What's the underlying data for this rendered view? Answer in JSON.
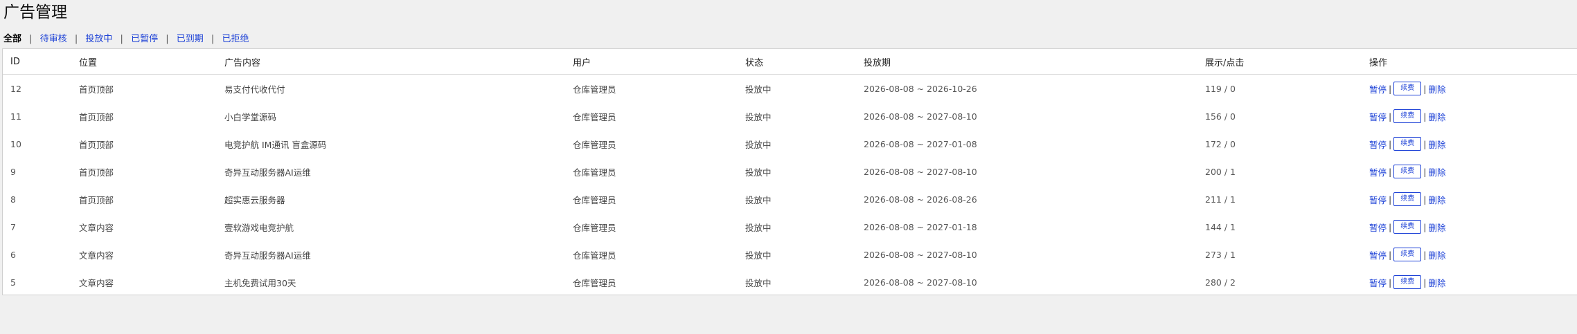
{
  "page": {
    "title": "广告管理"
  },
  "filters": [
    {
      "label": "全部",
      "active": true
    },
    {
      "label": "待审核",
      "active": false
    },
    {
      "label": "投放中",
      "active": false
    },
    {
      "label": "已暂停",
      "active": false
    },
    {
      "label": "已到期",
      "active": false
    },
    {
      "label": "已拒绝",
      "active": false
    }
  ],
  "filter_separator": "|",
  "table": {
    "headers": {
      "id": "ID",
      "position": "位置",
      "content": "广告内容",
      "user": "用户",
      "status": "状态",
      "period": "投放期",
      "stats": "展示/点击",
      "actions": "操作"
    },
    "rows": [
      {
        "id": "12",
        "position": "首页顶部",
        "content": "易支付代收代付",
        "user": "仓库管理员",
        "status": "投放中",
        "period": "2026-08-08 ~ 2026-10-26",
        "stats": "119 / 0"
      },
      {
        "id": "11",
        "position": "首页顶部",
        "content": "小白学堂源码",
        "user": "仓库管理员",
        "status": "投放中",
        "period": "2026-08-08 ~ 2027-08-10",
        "stats": "156 / 0"
      },
      {
        "id": "10",
        "position": "首页顶部",
        "content": "电竞护航 IM通讯 盲盒源码",
        "user": "仓库管理员",
        "status": "投放中",
        "period": "2026-08-08 ~ 2027-01-08",
        "stats": "172 / 0"
      },
      {
        "id": "9",
        "position": "首页顶部",
        "content": "奇异互动服务器AI运维",
        "user": "仓库管理员",
        "status": "投放中",
        "period": "2026-08-08 ~ 2027-08-10",
        "stats": "200 / 1"
      },
      {
        "id": "8",
        "position": "首页顶部",
        "content": "超实惠云服务器",
        "user": "仓库管理员",
        "status": "投放中",
        "period": "2026-08-08 ~ 2026-08-26",
        "stats": "211 / 1"
      },
      {
        "id": "7",
        "position": "文章内容",
        "content": "壹软游戏电竞护航",
        "user": "仓库管理员",
        "status": "投放中",
        "period": "2026-08-08 ~ 2027-01-18",
        "stats": "144 / 1"
      },
      {
        "id": "6",
        "position": "文章内容",
        "content": "奇异互动服务器AI运维",
        "user": "仓库管理员",
        "status": "投放中",
        "period": "2026-08-08 ~ 2027-08-10",
        "stats": "273 / 1"
      },
      {
        "id": "5",
        "position": "文章内容",
        "content": "主机免费试用30天",
        "user": "仓库管理员",
        "status": "投放中",
        "period": "2026-08-08 ~ 2027-08-10",
        "stats": "280 / 2"
      }
    ],
    "actions": {
      "pause": "暂停",
      "renew": "续费",
      "delete": "删除",
      "separator": "|"
    }
  },
  "colors": {
    "link": "#1a3fd6",
    "background": "#f0f0f0",
    "panel": "#ffffff",
    "border": "#cfcfcf"
  }
}
